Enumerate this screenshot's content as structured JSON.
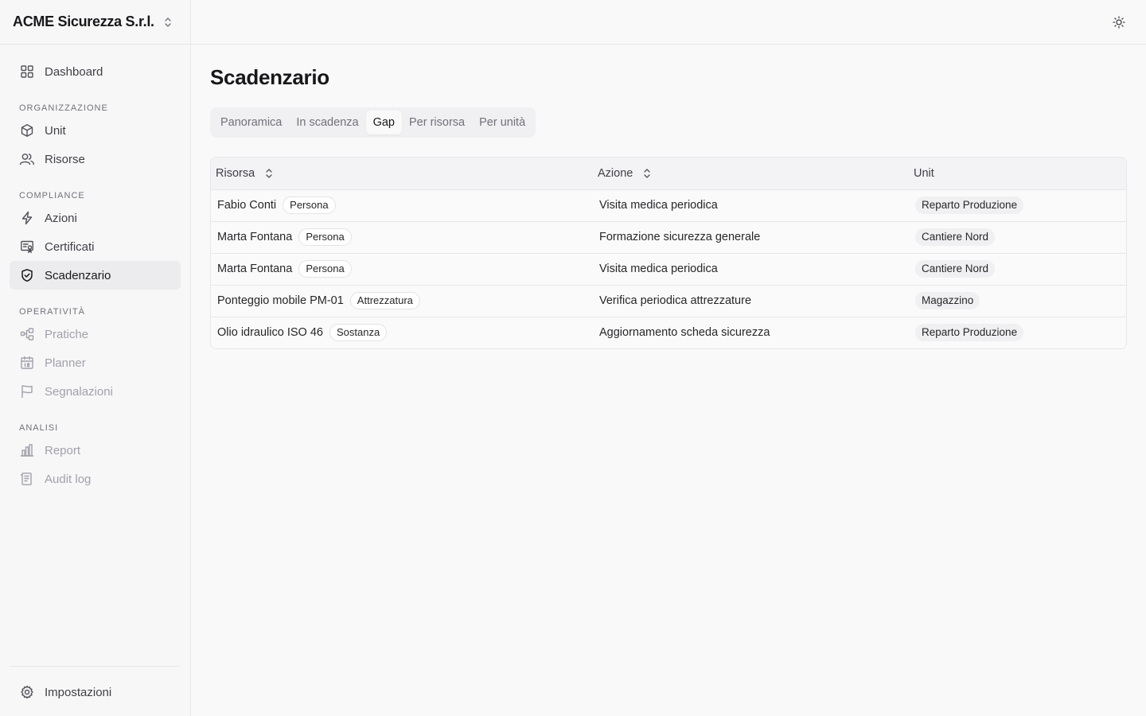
{
  "org": {
    "name": "ACME Sicurezza S.r.l."
  },
  "sidebar": {
    "top": [
      {
        "label": "Dashboard",
        "icon": "dashboard-grid-icon"
      }
    ],
    "sections": [
      {
        "title": "ORGANIZZAZIONE",
        "items": [
          {
            "label": "Unit",
            "icon": "cube-icon"
          },
          {
            "label": "Risorse",
            "icon": "users-icon"
          }
        ]
      },
      {
        "title": "COMPLIANCE",
        "items": [
          {
            "label": "Azioni",
            "icon": "lightning-icon"
          },
          {
            "label": "Certificati",
            "icon": "certificate-icon"
          },
          {
            "label": "Scadenzario",
            "icon": "shield-check-icon",
            "active": true
          }
        ]
      },
      {
        "title": "OPERATIVITÀ",
        "items": [
          {
            "label": "Pratiche",
            "icon": "workflow-icon",
            "disabled": true
          },
          {
            "label": "Planner",
            "icon": "calendar-icon",
            "disabled": true
          },
          {
            "label": "Segnalazioni",
            "icon": "flag-icon",
            "disabled": true
          }
        ]
      },
      {
        "title": "ANALISI",
        "items": [
          {
            "label": "Report",
            "icon": "bar-chart-icon",
            "disabled": true
          },
          {
            "label": "Audit log",
            "icon": "receipt-icon",
            "disabled": true
          }
        ]
      }
    ],
    "footer": {
      "label": "Impostazioni",
      "icon": "gear-icon"
    }
  },
  "page": {
    "title": "Scadenzario",
    "tabs": [
      {
        "label": "Panoramica"
      },
      {
        "label": "In scadenza"
      },
      {
        "label": "Gap",
        "active": true
      },
      {
        "label": "Per risorsa"
      },
      {
        "label": "Per unità"
      }
    ]
  },
  "table": {
    "headers": {
      "resource": "Risorsa",
      "action": "Azione",
      "unit": "Unit"
    },
    "rows": [
      {
        "resource": "Fabio Conti",
        "type": "Persona",
        "action": "Visita medica periodica",
        "unit": "Reparto Produzione"
      },
      {
        "resource": "Marta Fontana",
        "type": "Persona",
        "action": "Formazione sicurezza generale",
        "unit": "Cantiere Nord"
      },
      {
        "resource": "Marta Fontana",
        "type": "Persona",
        "action": "Visita medica periodica",
        "unit": "Cantiere Nord"
      },
      {
        "resource": "Ponteggio mobile PM-01",
        "type": "Attrezzatura",
        "action": "Verifica periodica attrezzature",
        "unit": "Magazzino"
      },
      {
        "resource": "Olio idraulico ISO 46",
        "type": "Sostanza",
        "action": "Aggiornamento scheda sicurezza",
        "unit": "Reparto Produzione"
      }
    ]
  },
  "colors": {
    "background": "#f9f9fa",
    "sidebar": "#f7f7f8",
    "border": "#e7e7ea",
    "text": "#18181b",
    "muted": "#71717a",
    "disabled": "#a1a1aa",
    "active_bg": "#ececee"
  }
}
